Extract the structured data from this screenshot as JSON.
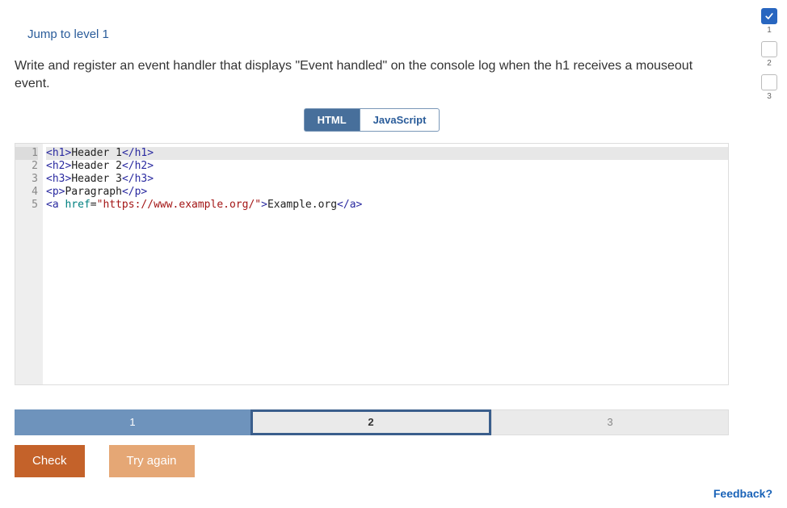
{
  "jump_link": "Jump to level 1",
  "prompt": "Write and register an event handler that displays \"Event handled\" on the console log when the h1 receives a mouseout event.",
  "tabs": {
    "html": "HTML",
    "js": "JavaScript",
    "active": "html"
  },
  "code_lines": [
    {
      "num": "1",
      "tokens": [
        [
          "<",
          "angle"
        ],
        [
          "h1",
          "tag"
        ],
        [
          ">",
          "angle"
        ],
        [
          "Header 1",
          "text"
        ],
        [
          "</",
          "angle"
        ],
        [
          "h1",
          "tag"
        ],
        [
          ">",
          "angle"
        ]
      ]
    },
    {
      "num": "2",
      "tokens": [
        [
          "<",
          "angle"
        ],
        [
          "h2",
          "tag"
        ],
        [
          ">",
          "angle"
        ],
        [
          "Header 2",
          "text"
        ],
        [
          "</",
          "angle"
        ],
        [
          "h2",
          "tag"
        ],
        [
          ">",
          "angle"
        ]
      ]
    },
    {
      "num": "3",
      "tokens": [
        [
          "<",
          "angle"
        ],
        [
          "h3",
          "tag"
        ],
        [
          ">",
          "angle"
        ],
        [
          "Header 3",
          "text"
        ],
        [
          "</",
          "angle"
        ],
        [
          "h3",
          "tag"
        ],
        [
          ">",
          "angle"
        ]
      ]
    },
    {
      "num": "4",
      "tokens": [
        [
          "<",
          "angle"
        ],
        [
          "p",
          "tag"
        ],
        [
          ">",
          "angle"
        ],
        [
          "Paragraph",
          "text"
        ],
        [
          "</",
          "angle"
        ],
        [
          "p",
          "tag"
        ],
        [
          ">",
          "angle"
        ]
      ]
    },
    {
      "num": "5",
      "tokens": [
        [
          "<",
          "angle"
        ],
        [
          "a",
          "tag"
        ],
        [
          " ",
          "text"
        ],
        [
          "href",
          "attr"
        ],
        [
          "=",
          "eq"
        ],
        [
          "\"https://www.example.org/\"",
          "str"
        ],
        [
          ">",
          "angle"
        ],
        [
          "Example.org",
          "text"
        ],
        [
          "</",
          "angle"
        ],
        [
          "a",
          "tag"
        ],
        [
          ">",
          "angle"
        ]
      ]
    }
  ],
  "highlighted_line_index": 0,
  "steps": [
    {
      "label": "1",
      "state": "done"
    },
    {
      "label": "2",
      "state": "current"
    },
    {
      "label": "3",
      "state": "future"
    }
  ],
  "buttons": {
    "check": "Check",
    "try_again": "Try again"
  },
  "side_progress": [
    {
      "label": "1",
      "state": "done"
    },
    {
      "label": "2",
      "state": "pending"
    },
    {
      "label": "3",
      "state": "pending"
    }
  ],
  "feedback": "Feedback?"
}
